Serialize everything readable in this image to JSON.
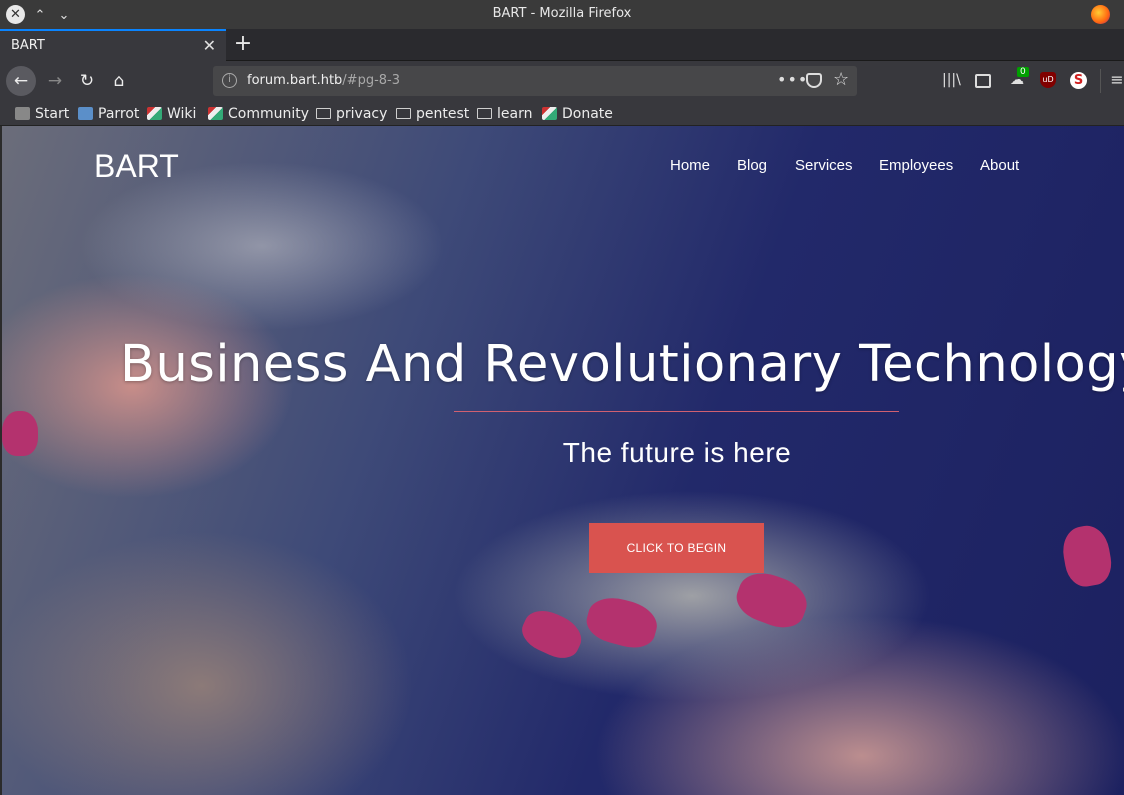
{
  "window": {
    "title": "BART - Mozilla Firefox",
    "controls": {
      "close": "✕",
      "up": "⌃",
      "down": "⌄"
    }
  },
  "tabs": [
    {
      "title": "BART",
      "close": "✕"
    }
  ],
  "toolbar": {
    "new_tab": "+",
    "back": "←",
    "forward": "→",
    "reload": "↻",
    "home": "⌂",
    "url_host": "forum.bart.htb",
    "url_rest": "/#pg-8-3",
    "url_prefix": "",
    "page_actions": "•••",
    "bookmark_star": "☆",
    "library": "|||\\",
    "extension_badge": "0",
    "ublock_label": "uD",
    "ext3_label": "S",
    "menu": "≡"
  },
  "bookmarks": [
    {
      "label": "Start",
      "icon": "star-icon"
    },
    {
      "label": "Parrot",
      "icon": "parrot-icon"
    },
    {
      "label": "Wiki",
      "icon": "kali-icon"
    },
    {
      "label": "Community",
      "icon": "kali-icon"
    },
    {
      "label": "privacy",
      "icon": "folder-icon"
    },
    {
      "label": "pentest",
      "icon": "folder-icon"
    },
    {
      "label": "learn",
      "icon": "folder-icon"
    },
    {
      "label": "Donate",
      "icon": "kali-icon"
    }
  ],
  "site": {
    "brand": "BART",
    "nav": [
      "Home",
      "Blog",
      "Services",
      "Employees",
      "About"
    ],
    "hero_title": "Business And Revolutionary Technology",
    "hero_subtitle": "The future is here",
    "cta_label": "CLICK TO BEGIN"
  },
  "colors": {
    "accent": "#0a84ff",
    "cta": "#d9534f",
    "hero_rule": "#d06070"
  }
}
